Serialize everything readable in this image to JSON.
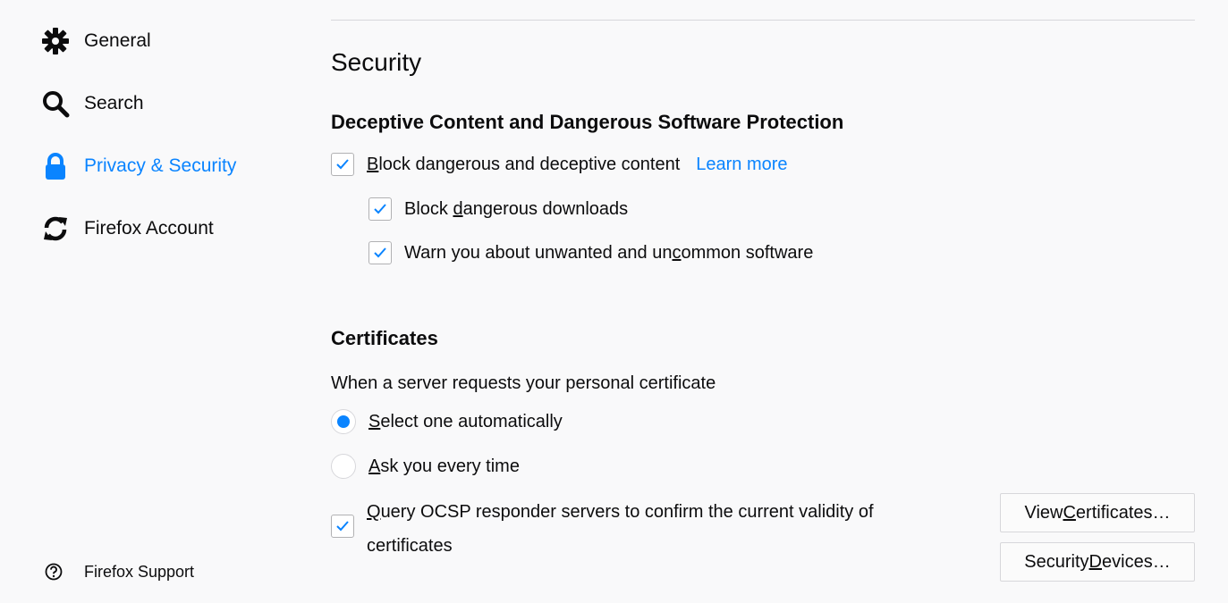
{
  "sidebar": {
    "items": [
      {
        "label": "General",
        "icon": "gear-icon",
        "selected": false
      },
      {
        "label": "Search",
        "icon": "search-icon",
        "selected": false
      },
      {
        "label": "Privacy & Security",
        "icon": "lock-icon",
        "selected": true
      },
      {
        "label": "Firefox Account",
        "icon": "sync-icon",
        "selected": false
      }
    ],
    "support": {
      "label": "Firefox Support",
      "icon": "help-icon"
    }
  },
  "main": {
    "section_title": "Security",
    "deceptive": {
      "heading": "Deceptive Content and Dangerous Software Protection",
      "block_content": {
        "pre": "",
        "accel": "B",
        "post": "lock dangerous and deceptive content",
        "checked": true
      },
      "learn_more": "Learn more",
      "block_downloads": {
        "pre": "Block ",
        "accel": "d",
        "post": "angerous downloads",
        "checked": true
      },
      "warn_unwanted": {
        "pre": "Warn you about unwanted and un",
        "accel": "c",
        "post": "ommon software",
        "checked": true
      }
    },
    "certificates": {
      "heading": "Certificates",
      "intro": "When a server requests your personal certificate",
      "select_auto": {
        "pre": "",
        "accel": "S",
        "post": "elect one automatically",
        "selected": true
      },
      "ask_every": {
        "pre": "",
        "accel": "A",
        "post": "sk you every time",
        "selected": false
      },
      "ocsp": {
        "pre": "",
        "accel": "Q",
        "post": "uery OCSP responder servers to confirm the current validity of certificates",
        "checked": true
      },
      "view_button": {
        "pre": "View ",
        "accel": "C",
        "post": "ertificates…"
      },
      "devices_button": {
        "pre": "Security ",
        "accel": "D",
        "post": "evices…"
      }
    }
  },
  "colors": {
    "accent": "#0a84ff",
    "background": "#f9f9fa",
    "text": "#0c0c0d",
    "border": "#d7d7db"
  }
}
